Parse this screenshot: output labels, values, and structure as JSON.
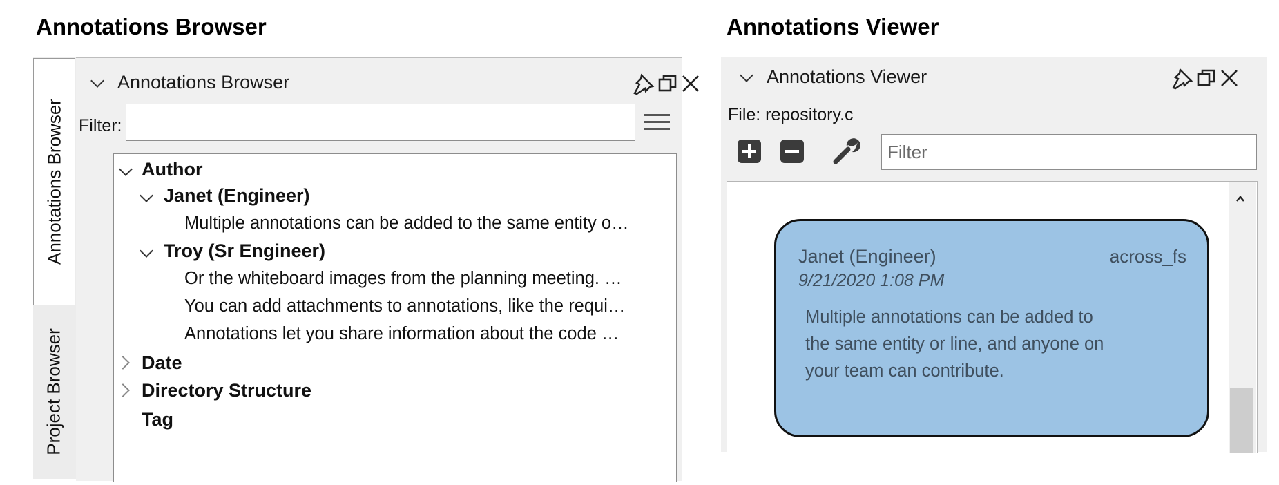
{
  "browser": {
    "section_title": "Annotations Browser",
    "tabs": [
      "Annotations Browser",
      "Project Browser"
    ],
    "header_title": "Annotations Browser",
    "filter_label": "Filter:",
    "filter_value": "",
    "tree": [
      {
        "label": "Author",
        "expanded": true
      },
      {
        "label": "Janet (Engineer)",
        "expanded": true
      },
      {
        "label": "Multiple annotations can be added to the same entity o…"
      },
      {
        "label": "Troy (Sr Engineer)",
        "expanded": true
      },
      {
        "label": "Or the whiteboard images from the planning meeting. …"
      },
      {
        "label": "You can add attachments to annotations, like the requi…"
      },
      {
        "label": "Annotations let you share information about the code …"
      },
      {
        "label": "Date",
        "expanded": false
      },
      {
        "label": "Directory Structure",
        "expanded": false
      },
      {
        "label": "Tag"
      }
    ]
  },
  "viewer": {
    "section_title": "Annotations Viewer",
    "header_title": "Annotations Viewer",
    "file_label": "File: repository.c",
    "filter_placeholder": "Filter",
    "card": {
      "author": "Janet (Engineer)",
      "entity": "across_fs",
      "date": "9/21/2020 1:08 PM",
      "body_lines": [
        "Multiple annotations can be added to",
        "the same entity or line, and anyone on",
        "your team can contribute."
      ],
      "color": "#9cc3e4"
    }
  },
  "icons": {
    "pin": "pin-icon",
    "restore": "restore-icon",
    "close": "close-icon",
    "menu": "hamburger-menu-icon",
    "add": "plus-icon",
    "remove": "minus-icon",
    "settings": "wrench-icon"
  }
}
